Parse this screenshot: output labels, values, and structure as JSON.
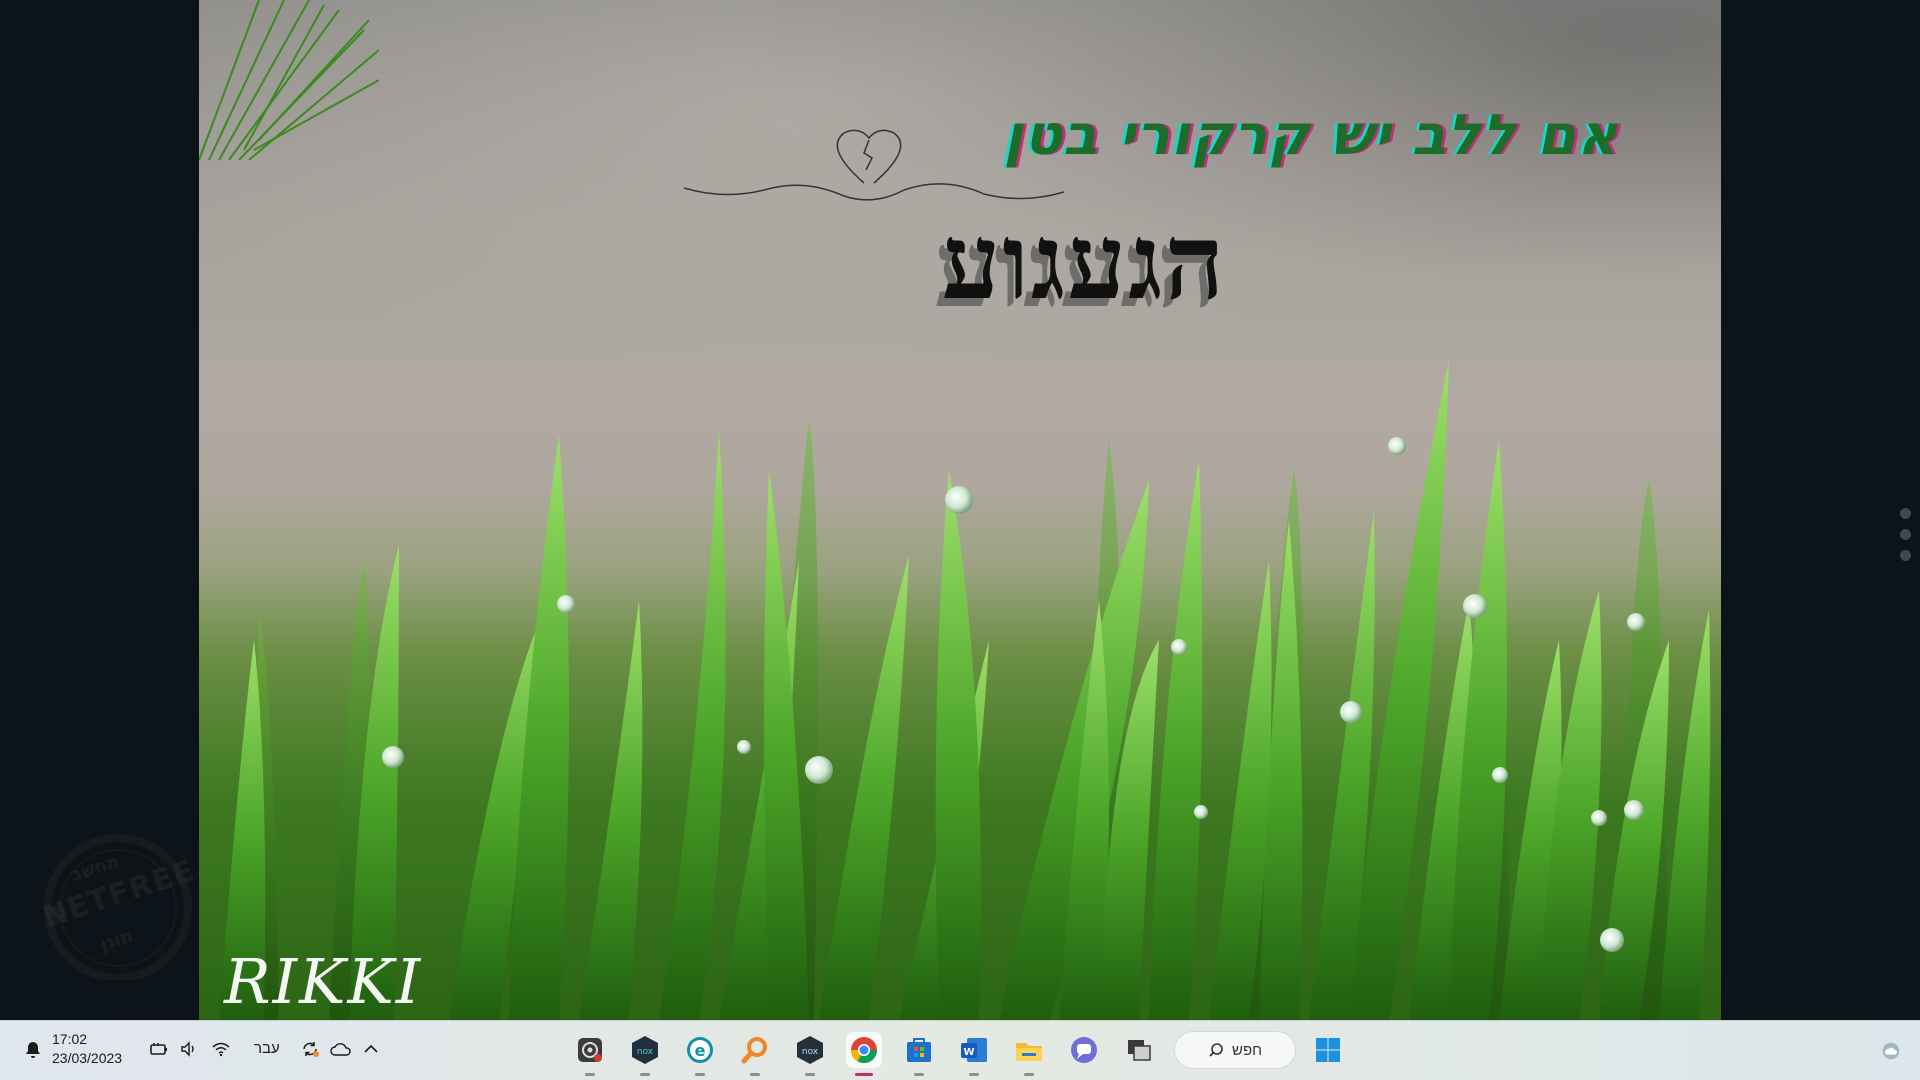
{
  "slide": {
    "subtitle": "אם ללב יש קרקורי בטן",
    "title": "הגעגוע",
    "signature": "RIKKI"
  },
  "watermark": {
    "brand": "NETFREE",
    "top_text": "מחשב",
    "bottom_text": "מוגן"
  },
  "taskbar": {
    "clock_time": "17:02",
    "clock_date": "23/03/2023",
    "language": "עבר",
    "search_label": "חפש",
    "apps": [
      {
        "name": "obs-icon"
      },
      {
        "name": "nox-icon"
      },
      {
        "name": "edge-e-icon"
      },
      {
        "name": "search-tool-icon"
      },
      {
        "name": "nox-player-icon"
      },
      {
        "name": "chrome-icon"
      },
      {
        "name": "store-icon"
      },
      {
        "name": "word-icon"
      },
      {
        "name": "file-explorer-icon"
      },
      {
        "name": "teams-chat-icon"
      },
      {
        "name": "task-view-icon"
      }
    ]
  },
  "colors": {
    "desktop_bg": "#0c1319",
    "subtitle_green": "#1f6b2a",
    "title_black": "#111111",
    "taskbar_bg": "#e2e8ea",
    "active_indicator": "#c0306a"
  }
}
